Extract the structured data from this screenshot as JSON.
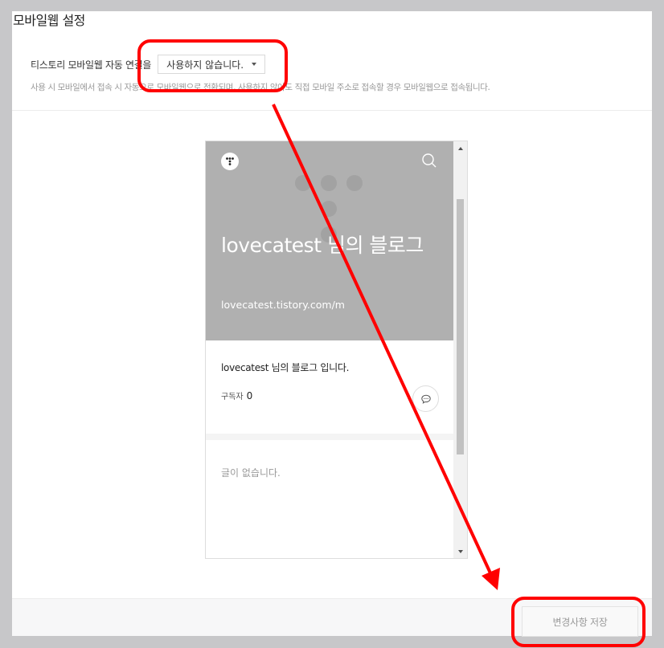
{
  "page": {
    "title": "모바일웹 설정"
  },
  "setting": {
    "label": "티스토리 모바일웹 자동 연결을",
    "selected_option": "사용하지 않습니다.",
    "description": "사용 시 모바일에서 접속 시 자동으로 모바일웹으로 전환되며, 사용하지 않아도 직접 모바일 주소로 접속할 경우 모바일웹으로 접속됩니다."
  },
  "preview": {
    "blog_title": "lovecatest 님의 블로그",
    "blog_url": "lovecatest.tistory.com/m",
    "description": "lovecatest 님의 블로그 입니다.",
    "subscribers_label": "구독자",
    "subscribers_count": "0",
    "empty_posts": "글이 없습니다."
  },
  "footer": {
    "save_label": "변경사항 저장"
  },
  "colors": {
    "annotation_red": "#ff0000",
    "hero_bg": "#b0b0b0",
    "page_bg": "#c7c7c9"
  },
  "icons": [
    "tistory-logo-icon",
    "search-icon",
    "chat-bubble-icon",
    "scroll-up-icon",
    "scroll-down-icon"
  ]
}
